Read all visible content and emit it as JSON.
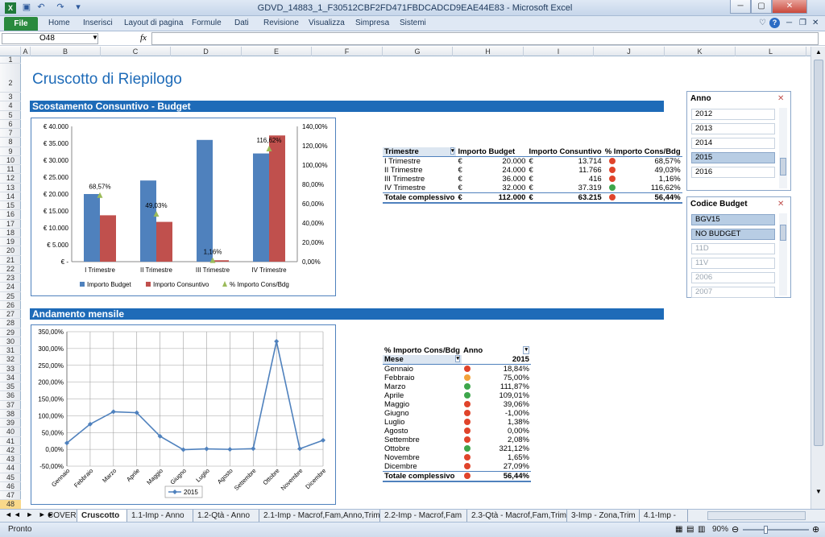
{
  "window": {
    "title": "GDVD_14883_1_F30512CBF2FD471FBDCADCD9EAE44E83 - Microsoft Excel"
  },
  "ribbon": {
    "file": "File",
    "tabs": [
      "Home",
      "Inserisci",
      "Layout di pagina",
      "Formule",
      "Dati",
      "Revisione",
      "Visualizza",
      "Simpresa",
      "Sistemi"
    ]
  },
  "formula": {
    "cell": "O48",
    "fx": "fx",
    "value": ""
  },
  "columns": [
    "A",
    "B",
    "C",
    "D",
    "E",
    "F",
    "G",
    "H",
    "I",
    "J",
    "K",
    "L"
  ],
  "rows": [
    "1",
    "2",
    "3",
    "4",
    "5",
    "6",
    "7",
    "8",
    "9",
    "10",
    "11",
    "12",
    "13",
    "14",
    "15",
    "16",
    "17",
    "18",
    "19",
    "20",
    "21",
    "22",
    "23",
    "24",
    "25",
    "26",
    "27",
    "28",
    "29",
    "30",
    "31",
    "32",
    "33",
    "34",
    "35",
    "36",
    "37",
    "38",
    "39",
    "40",
    "41",
    "42",
    "43",
    "44",
    "45",
    "46",
    "47",
    "48"
  ],
  "page": {
    "title": "Cruscotto di Riepilogo",
    "section1": "Scostamento Consuntivo - Budget",
    "section2": "Andamento mensile"
  },
  "chart_data": [
    {
      "type": "bar",
      "categories": [
        "I Trimestre",
        "II Trimestre",
        "III Trimestre",
        "IV Trimestre"
      ],
      "series": [
        {
          "name": "Importo Budget",
          "values": [
            20000,
            24000,
            36000,
            32000
          ],
          "color": "#4f81bd"
        },
        {
          "name": "Importo Consuntivo",
          "values": [
            13714,
            11766,
            416,
            37319
          ],
          "color": "#c0504d"
        },
        {
          "name": "% Importo Cons/Bdg",
          "values": [
            68.57,
            49.03,
            1.16,
            116.62
          ],
          "color": "#9bbb59",
          "axis": "secondary"
        }
      ],
      "y_ticks": [
        "€ 40.000",
        "€ 35.000",
        "€ 30.000",
        "€ 25.000",
        "€ 20.000",
        "€ 15.000",
        "€ 10.000",
        "€ 5.000",
        "€ -"
      ],
      "y2_ticks": [
        "140,00%",
        "120,00%",
        "100,00%",
        "80,00%",
        "60,00%",
        "40,00%",
        "20,00%",
        "0,00%"
      ],
      "data_labels": [
        "68,57%",
        "49,03%",
        "1,16%",
        "116,62%"
      ],
      "ylim": [
        0,
        40000
      ],
      "y2lim": [
        0,
        140
      ],
      "legend": "bottom"
    },
    {
      "type": "line",
      "categories": [
        "Gennaio",
        "Febbraio",
        "Marzo",
        "Aprile",
        "Maggio",
        "Giugno",
        "Luglio",
        "Agosto",
        "Settembre",
        "Ottobre",
        "Novembre",
        "Dicembre"
      ],
      "series": [
        {
          "name": "2015",
          "values": [
            18.84,
            75.0,
            111.87,
            109.01,
            39.06,
            -1.0,
            1.38,
            0.0,
            2.08,
            321.12,
            1.65,
            27.09
          ],
          "color": "#4f81bd"
        }
      ],
      "y_ticks": [
        "350,00%",
        "300,00%",
        "250,00%",
        "200,00%",
        "150,00%",
        "100,00%",
        "50,00%",
        "0,00%",
        "-50,00%"
      ],
      "ylim": [
        -50,
        350
      ],
      "grid": true,
      "legend": "bottom"
    }
  ],
  "pivot1": {
    "headers": [
      "Trimestre",
      "Importo Budget",
      "Importo Consuntivo",
      "% Importo Cons/Bdg"
    ],
    "rows": [
      {
        "label": "I Trimestre",
        "cur1": "€",
        "budget": "20.000",
        "cur2": "€",
        "cons": "13.714",
        "status": "red",
        "pct": "68,57%"
      },
      {
        "label": "II Trimestre",
        "cur1": "€",
        "budget": "24.000",
        "cur2": "€",
        "cons": "11.766",
        "status": "red",
        "pct": "49,03%"
      },
      {
        "label": "III Trimestre",
        "cur1": "€",
        "budget": "36.000",
        "cur2": "€",
        "cons": "416",
        "status": "red",
        "pct": "1,16%"
      },
      {
        "label": "IV Trimestre",
        "cur1": "€",
        "budget": "32.000",
        "cur2": "€",
        "cons": "37.319",
        "status": "green",
        "pct": "116,62%"
      }
    ],
    "total": {
      "label": "Totale complessivo",
      "cur1": "€",
      "budget": "112.000",
      "cur2": "€",
      "cons": "63.215",
      "status": "red",
      "pct": "56,44%"
    }
  },
  "pivot2": {
    "h1": "% Importo Cons/Bdg",
    "h2": "Anno",
    "h3": "Mese",
    "year": "2015",
    "rows": [
      {
        "label": "Gennaio",
        "status": "red",
        "pct": "18,84%"
      },
      {
        "label": "Febbraio",
        "status": "yellow",
        "pct": "75,00%"
      },
      {
        "label": "Marzo",
        "status": "green",
        "pct": "111,87%"
      },
      {
        "label": "Aprile",
        "status": "green",
        "pct": "109,01%"
      },
      {
        "label": "Maggio",
        "status": "red",
        "pct": "39,06%"
      },
      {
        "label": "Giugno",
        "status": "red",
        "pct": "-1,00%"
      },
      {
        "label": "Luglio",
        "status": "red",
        "pct": "1,38%"
      },
      {
        "label": "Agosto",
        "status": "red",
        "pct": "0,00%"
      },
      {
        "label": "Settembre",
        "status": "red",
        "pct": "2,08%"
      },
      {
        "label": "Ottobre",
        "status": "green",
        "pct": "321,12%"
      },
      {
        "label": "Novembre",
        "status": "red",
        "pct": "1,65%"
      },
      {
        "label": "Dicembre",
        "status": "red",
        "pct": "27,09%"
      }
    ],
    "total": {
      "label": "Totale complessivo",
      "status": "red",
      "pct": "56,44%"
    }
  },
  "slicer_anno": {
    "title": "Anno",
    "items": [
      {
        "label": "2012",
        "state": "normal"
      },
      {
        "label": "2013",
        "state": "normal"
      },
      {
        "label": "2014",
        "state": "normal"
      },
      {
        "label": "2015",
        "state": "selected"
      },
      {
        "label": "2016",
        "state": "normal"
      }
    ]
  },
  "slicer_budget": {
    "title": "Codice Budget",
    "items": [
      {
        "label": "BGV15",
        "state": "selected"
      },
      {
        "label": "NO BUDGET",
        "state": "selected"
      },
      {
        "label": "11D",
        "state": "dim"
      },
      {
        "label": "11V",
        "state": "dim"
      },
      {
        "label": "2006",
        "state": "dim"
      },
      {
        "label": "2007",
        "state": "dim"
      }
    ]
  },
  "sheets": [
    "COVER",
    "Cruscotto",
    "1.1-Imp - Anno",
    "1.2-Qtà - Anno",
    "2.1-Imp - Macrof,Fam,Anno,Trim",
    "2.2-Imp - Macrof,Fam",
    "2.3-Qtà - Macrof,Fam,Trim",
    "3-Imp - Zona,Trim",
    "4.1-Imp -"
  ],
  "status": {
    "ready": "Pronto",
    "zoom": "90%"
  },
  "colors": {
    "accent": "#1e6bb8",
    "budget": "#4f81bd",
    "consuntivo": "#c0504d",
    "pct": "#9bbb59"
  }
}
